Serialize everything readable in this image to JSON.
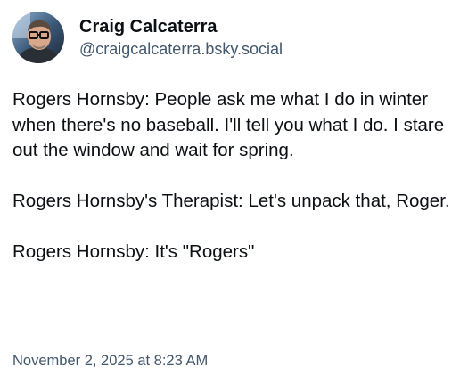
{
  "author": {
    "display_name": "Craig Calcaterra",
    "handle": "@craigcalcaterra.bsky.social",
    "avatar_icon": "person-with-glasses-avatar"
  },
  "post": {
    "paragraphs": [
      "Rogers Hornsby: People ask me what I do in winter when there's no baseball. I'll tell you what I do. I stare out the window and wait for spring.",
      "Rogers Hornsby's Therapist: Let's unpack that, Roger.",
      "Rogers Hornsby: It's \"Rogers\""
    ],
    "timestamp": "November 2, 2025 at 8:23 AM"
  },
  "colors": {
    "text": "#0b0f14",
    "secondary_text": "#42576c",
    "background": "#ffffff"
  }
}
